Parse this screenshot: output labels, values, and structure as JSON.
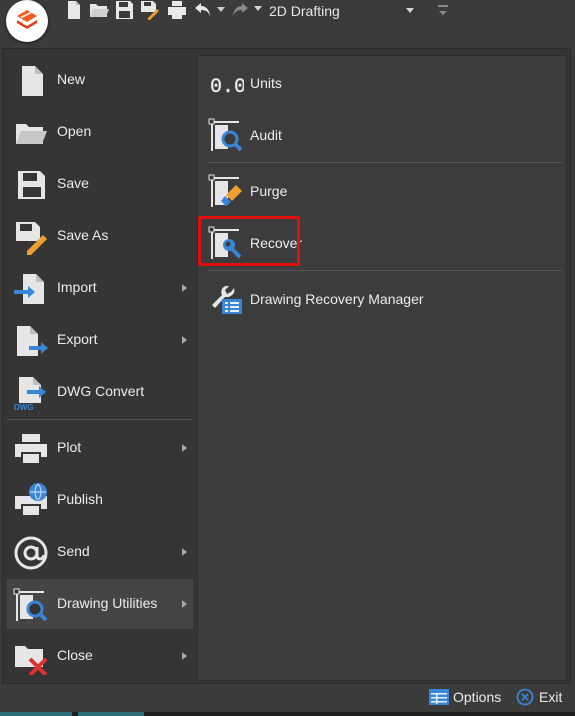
{
  "quick_access": {
    "icons": [
      "new-icon",
      "open-icon",
      "save-icon",
      "save-as-icon",
      "print-icon",
      "undo-icon",
      "redo-icon"
    ],
    "workspace": "2D Drafting"
  },
  "left_menu": [
    {
      "label": "New",
      "icon": "new-file-icon",
      "submenu": false
    },
    {
      "label": "Open",
      "icon": "open-folder-icon",
      "submenu": false
    },
    {
      "label": "Save",
      "icon": "save-icon",
      "submenu": false
    },
    {
      "label": "Save As",
      "icon": "save-as-icon",
      "submenu": false
    },
    {
      "label": "Import",
      "icon": "import-icon",
      "submenu": true
    },
    {
      "label": "Export",
      "icon": "export-icon",
      "submenu": true
    },
    {
      "label": "DWG Convert",
      "icon": "dwg-convert-icon",
      "submenu": false
    },
    {
      "label": "Plot",
      "icon": "plot-icon",
      "submenu": true
    },
    {
      "label": "Publish",
      "icon": "publish-icon",
      "submenu": false
    },
    {
      "label": "Send",
      "icon": "send-icon",
      "submenu": true
    },
    {
      "label": "Drawing Utilities",
      "icon": "drawing-utilities-icon",
      "submenu": true,
      "active": true
    },
    {
      "label": "Close",
      "icon": "close-file-icon",
      "submenu": true
    }
  ],
  "right_menu": [
    {
      "label": "Units",
      "icon": "units-icon",
      "units_glyph": "0.0"
    },
    {
      "label": "Audit",
      "icon": "audit-icon"
    },
    {
      "label": "Purge",
      "icon": "purge-icon"
    },
    {
      "label": "Recover",
      "icon": "recover-icon",
      "highlighted": true
    },
    {
      "label": "Drawing Recovery Manager",
      "icon": "drawing-recovery-manager-icon"
    }
  ],
  "footer": {
    "options_label": "Options",
    "exit_label": "Exit"
  },
  "colors": {
    "highlight": "#e01010",
    "accent_blue": "#3a86d6",
    "accent_orange": "#f0a030"
  }
}
